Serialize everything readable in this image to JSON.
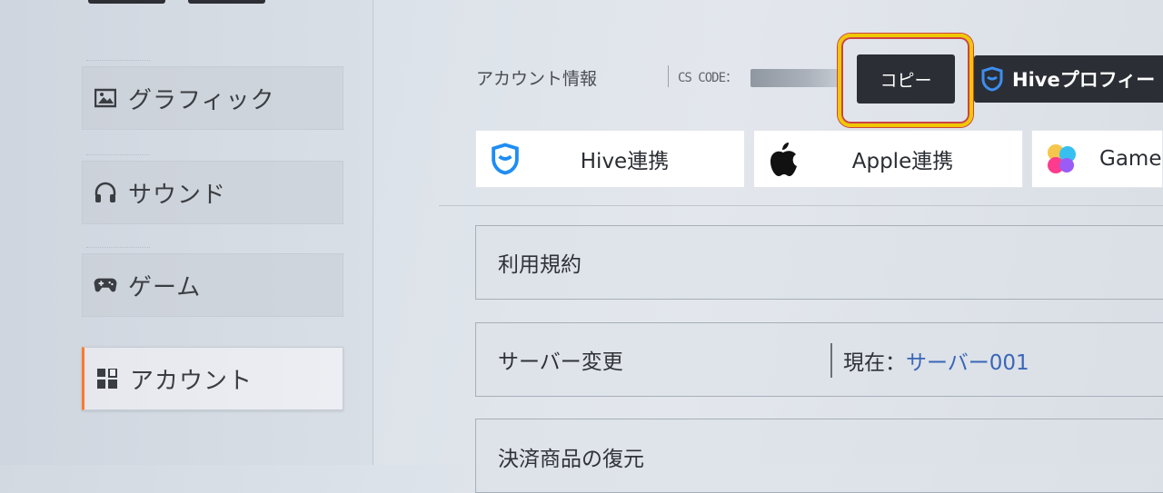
{
  "sidebar": {
    "items": [
      {
        "label": "グラフィック",
        "icon": "image-icon"
      },
      {
        "label": "サウンド",
        "icon": "headphones-icon"
      },
      {
        "label": "ゲーム",
        "icon": "gamepad-icon"
      },
      {
        "label": "アカウント",
        "icon": "account-grid-icon",
        "active": true
      }
    ]
  },
  "account": {
    "label": "アカウント情報",
    "cs_code_label": "CS CODE：",
    "copy_button": "コピー",
    "hive_profile_button": "Hiveプロフィー"
  },
  "link_buttons": [
    {
      "label": "Hive連携",
      "icon": "hive-shield-icon"
    },
    {
      "label": "Apple連携",
      "icon": "apple-icon"
    },
    {
      "label": "Game",
      "icon": "game-center-icon"
    }
  ],
  "rows": {
    "terms": "利用規約",
    "server_change": "サーバー変更",
    "current_prefix": "現在：",
    "current_server": "サーバー001",
    "restore_purchases": "決済商品の復元"
  },
  "colors": {
    "accent_orange": "#ff7a2a",
    "highlight_yellow": "#f0c800",
    "server_blue": "#3a66b8",
    "dark_button": "#2b2e34"
  }
}
